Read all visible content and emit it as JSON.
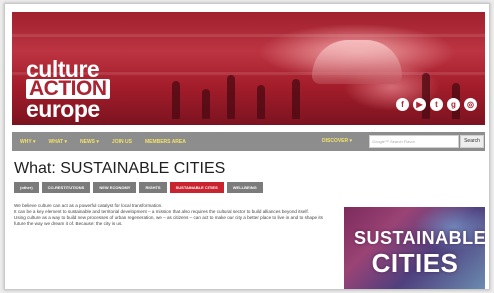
{
  "header": {
    "logo_lines": [
      "culture",
      "ACTION",
      "europe"
    ],
    "social_icons": [
      "facebook-icon",
      "youtube-icon",
      "twitter-icon",
      "google-plus-icon",
      "instagram-icon"
    ]
  },
  "nav": {
    "items": [
      "WHY ▾",
      "WHAT ▾",
      "NEWS ▾",
      "JOIN US",
      "MEMBERS AREA"
    ],
    "discover_label": "DISCOVER ▾",
    "search_placeholder": "Google™ Search Flavor",
    "search_button": "Search"
  },
  "main": {
    "title": "What: SUSTAINABLE CITIES",
    "tags": [
      {
        "label": "(other)",
        "active": false
      },
      {
        "label": "CO-RESTITUTIONS",
        "active": false
      },
      {
        "label": "NEW ECONOMY",
        "active": false
      },
      {
        "label": "RIGHTS",
        "active": false
      },
      {
        "label": "SUSTAINABLE CITIES",
        "active": true
      },
      {
        "label": "WELLBEING",
        "active": false
      }
    ],
    "intro": [
      "We believe culture can act as a powerful catalyst for local transformation.",
      "It can be a key element to sustainable and territorial development – a mission that also requires the cultural sector to build alliances beyond itself.",
      "Using culture as a way to build new processes of urban regeneration, we – as citizens – can act to make our city a better place to live in and to shape its future the way we dream it of. Because: the city is us."
    ],
    "side_image_text": [
      "SUSTAINABLE",
      "CITIES"
    ]
  },
  "colors": {
    "brand_red": "#ab2433",
    "nav_bg": "#8d8d8d",
    "nav_text": "#f3e26a",
    "tag_bg": "#7b7b7b",
    "tag_active": "#c8232f"
  }
}
